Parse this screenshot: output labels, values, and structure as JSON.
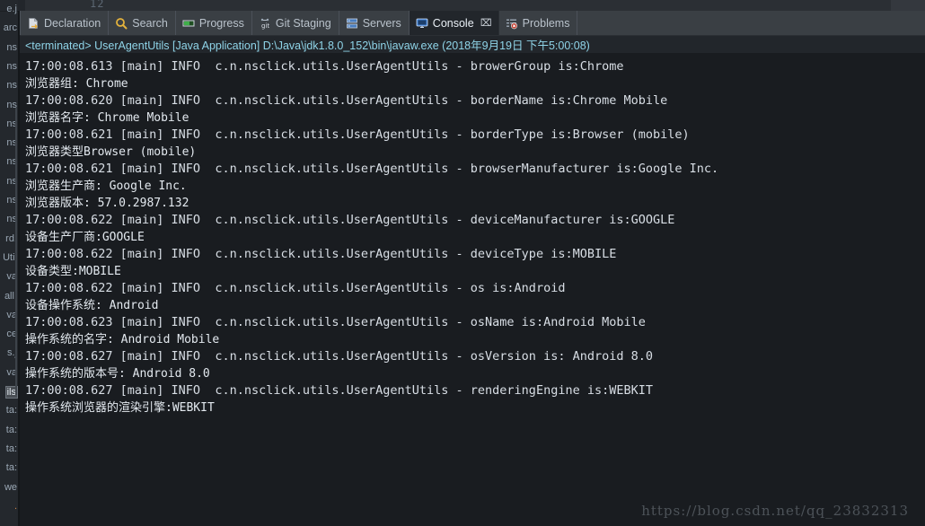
{
  "editor_remnant": {
    "line_number": "12"
  },
  "left_panel": {
    "fragments": [
      "e.j",
      "arc",
      "ns",
      "ns",
      "ns",
      "ns",
      "ns",
      "ns",
      "ns",
      "ns",
      "ns",
      "ns",
      "rd.",
      "Util",
      "va",
      "allI",
      "va",
      "ce",
      "s.j",
      "va",
      "ils",
      "ta:",
      "ta:",
      "ta:",
      "ta:",
      "we",
      "."
    ],
    "selected_fragment": "ils"
  },
  "tabs": [
    {
      "label": "Declaration",
      "icon": "declaration-icon",
      "active": false
    },
    {
      "label": "Search",
      "icon": "search-icon",
      "active": false
    },
    {
      "label": "Progress",
      "icon": "progress-icon",
      "active": false
    },
    {
      "label": "Git Staging",
      "icon": "git-staging-icon",
      "active": false
    },
    {
      "label": "Servers",
      "icon": "servers-icon",
      "active": false
    },
    {
      "label": "Console",
      "icon": "console-icon",
      "active": true,
      "closable": true,
      "close_label": "⌧"
    },
    {
      "label": "Problems",
      "icon": "problems-icon",
      "active": false
    }
  ],
  "console": {
    "terminated_header": "<terminated> UserAgentUtils [Java Application] D:\\Java\\jdk1.8.0_152\\bin\\javaw.exe (2018年9月19日 下午5:00:08)",
    "lines": [
      {
        "text": "17:00:08.613 [main] INFO  c.n.nsclick.utils.UserAgentUtils - browerGroup is:Chrome",
        "cn": false
      },
      {
        "text": "浏览器组: Chrome",
        "cn": true
      },
      {
        "text": "17:00:08.620 [main] INFO  c.n.nsclick.utils.UserAgentUtils - borderName is:Chrome Mobile",
        "cn": false
      },
      {
        "text": "浏览器名字: Chrome Mobile",
        "cn": true
      },
      {
        "text": "17:00:08.621 [main] INFO  c.n.nsclick.utils.UserAgentUtils - borderType is:Browser (mobile)",
        "cn": false
      },
      {
        "text": "浏览器类型Browser (mobile)",
        "cn": true
      },
      {
        "text": "17:00:08.621 [main] INFO  c.n.nsclick.utils.UserAgentUtils - browserManufacturer is:Google Inc.",
        "cn": false
      },
      {
        "text": "浏览器生产商: Google Inc.",
        "cn": true
      },
      {
        "text": "浏览器版本: 57.0.2987.132",
        "cn": true
      },
      {
        "text": "17:00:08.622 [main] INFO  c.n.nsclick.utils.UserAgentUtils - deviceManufacturer is:GOOGLE",
        "cn": false
      },
      {
        "text": "设备生产厂商:GOOGLE",
        "cn": true
      },
      {
        "text": "17:00:08.622 [main] INFO  c.n.nsclick.utils.UserAgentUtils - deviceType is:MOBILE",
        "cn": false
      },
      {
        "text": "设备类型:MOBILE",
        "cn": true
      },
      {
        "text": "17:00:08.622 [main] INFO  c.n.nsclick.utils.UserAgentUtils - os is:Android",
        "cn": false
      },
      {
        "text": "设备操作系统: Android",
        "cn": true
      },
      {
        "text": "17:00:08.623 [main] INFO  c.n.nsclick.utils.UserAgentUtils - osName is:Android Mobile",
        "cn": false
      },
      {
        "text": "操作系统的名字: Android Mobile",
        "cn": true
      },
      {
        "text": "17:00:08.627 [main] INFO  c.n.nsclick.utils.UserAgentUtils - osVersion is: Android 8.0",
        "cn": false
      },
      {
        "text": "操作系统的版本号: Android 8.0",
        "cn": true
      },
      {
        "text": "17:00:08.627 [main] INFO  c.n.nsclick.utils.UserAgentUtils - renderingEngine is:WEBKIT",
        "cn": false
      },
      {
        "text": "操作系统浏览器的渲染引擎:WEBKIT",
        "cn": true
      }
    ]
  },
  "watermark": "https://blog.csdn.net/qq_23832313",
  "colors": {
    "panel_bg": "#191c20",
    "tabbar_bg": "#3a3f44",
    "active_tab_bg": "#22262b",
    "header_text": "#8fd4e8",
    "log_text": "#d8dee5",
    "watermark_text": "#4d5359"
  }
}
